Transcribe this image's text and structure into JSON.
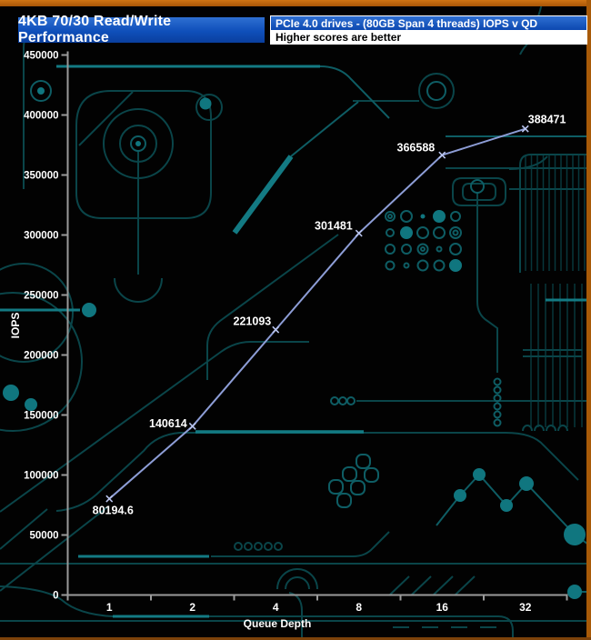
{
  "header": {
    "title": "4KB 70/30 Read/Write Performance",
    "subtitle": "PCIe 4.0 drives - (80GB Span 4 threads) IOPS v QD",
    "note": "Higher scores are better"
  },
  "colors": {
    "frame_orange": "#b96109",
    "header_blue": "#0f4fba",
    "circuit_teal": "#10656d",
    "axis_gray": "#9a9a9a",
    "text_white": "#ffffff"
  },
  "chart_data": {
    "type": "line",
    "categories": [
      "1",
      "2",
      "4",
      "8",
      "16",
      "32"
    ],
    "values": [
      80194.6,
      140614,
      221093,
      301481,
      366588,
      388471
    ],
    "point_labels": [
      "80194.6",
      "140614",
      "221093",
      "301481",
      "366588",
      "388471"
    ],
    "xlabel": "Queue Depth",
    "ylabel": "IOPS",
    "ylim": [
      0,
      450000
    ],
    "yticks": [
      0,
      50000,
      100000,
      150000,
      200000,
      250000,
      300000,
      350000,
      400000,
      450000
    ],
    "grid": false,
    "legend": "none",
    "line_color": "#8d9dd6",
    "marker": "x",
    "marker_color": "#b9c4ee"
  }
}
